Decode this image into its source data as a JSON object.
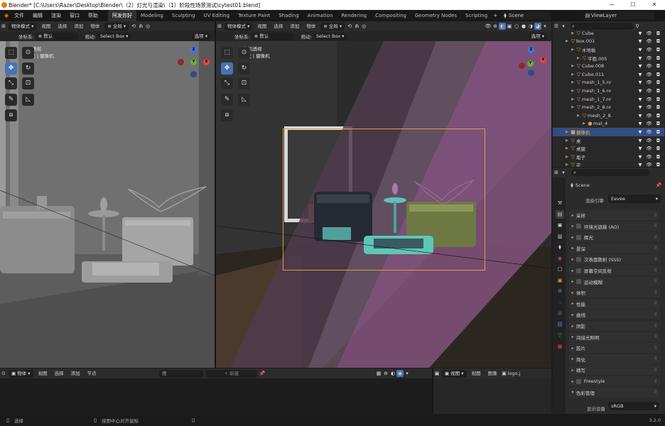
{
  "titlebar": {
    "title": "Blender* [C:\\Users\\Razer\\Desktop\\Blender\\（2）灯光与渲染\\（1）阶段性场景测试\\cytest01.blend]"
  },
  "menu": {
    "items": [
      "文件",
      "编辑",
      "渲染",
      "窗口",
      "帮助"
    ]
  },
  "workspaces": [
    "阿发你好",
    "Modeling",
    "Sculpting",
    "UV Editing",
    "Texture Paint",
    "Shading",
    "Animation",
    "Rendering",
    "Compositing",
    "Geometry Nodes",
    "Scripting"
  ],
  "top_right": {
    "scene": "Scene",
    "view_layer": "ViewLayer"
  },
  "viewport_left": {
    "mode": "物体模式",
    "menus": [
      "视图",
      "选择",
      "添加",
      "物体"
    ],
    "orientation": "全局",
    "coord_label": "坐标系:",
    "coord_value": "默认",
    "drag_label": "拖动:",
    "drag_value": "Select Box",
    "options": "选项",
    "overlay_title": "用户透视",
    "overlay_sub": "(1) 光 | 摄像机"
  },
  "viewport_right": {
    "mode": "物体模式",
    "menus": [
      "视图",
      "选择",
      "添加",
      "物体"
    ],
    "orientation": "全局",
    "coord_label": "坐标系:",
    "coord_value": "默认",
    "drag_label": "拖动:",
    "drag_value": "Select Box",
    "options": "选项",
    "overlay_title": "摄像机透视",
    "overlay_sub": "(1) 光 | 摄像机"
  },
  "gizmo": {
    "x": "X",
    "y": "Y",
    "z": "Z"
  },
  "outliner": {
    "rows": [
      {
        "name": "Cube",
        "indent": 3,
        "icon": "▽"
      },
      {
        "name": "box.001",
        "indent": 2,
        "icon": "▽"
      },
      {
        "name": "木地板",
        "indent": 3,
        "icon": "▽"
      },
      {
        "name": "平面.005",
        "indent": 4,
        "icon": "▽"
      },
      {
        "name": "Cube.008",
        "indent": 3,
        "icon": "▽"
      },
      {
        "name": "Cube.011",
        "indent": 3,
        "icon": "▽"
      },
      {
        "name": "mesh_1_5.nr",
        "indent": 3,
        "icon": "▽"
      },
      {
        "name": "mesh_1_6.nr",
        "indent": 3,
        "icon": "▽"
      },
      {
        "name": "mesh_1_7.nr",
        "indent": 3,
        "icon": "▽"
      },
      {
        "name": "mesh_2_8.nr",
        "indent": 3,
        "icon": "▽"
      },
      {
        "name": "mesh_2_8.",
        "indent": 4,
        "icon": "▽"
      },
      {
        "name": "mat_4",
        "indent": 5,
        "icon": "●"
      },
      {
        "name": "摄像机",
        "indent": 2,
        "icon": "■"
      },
      {
        "name": "桌",
        "indent": 2,
        "icon": "▽"
      },
      {
        "name": "桌腿",
        "indent": 2,
        "icon": "▽"
      },
      {
        "name": "瓶子",
        "indent": 2,
        "icon": "▽"
      },
      {
        "name": "花",
        "indent": 2,
        "icon": "▽"
      }
    ],
    "selected_index": 12
  },
  "properties": {
    "scene_name": "Scene",
    "render_engine_label": "渲染引擎",
    "render_engine_value": "Eevee",
    "panels": [
      "采样",
      "环境光遮蔽 (AO)",
      "辉光",
      "景深",
      "次表面散射 (SSS)",
      "屏幕空间反射",
      "运动模糊",
      "体积",
      "性能",
      "曲线",
      "阴影",
      "间接光照明",
      "胶片",
      "简化",
      "精写",
      "Freestyle",
      "色彩管理"
    ],
    "panels_with_checkbox": [
      1,
      2,
      4,
      5,
      6,
      15
    ],
    "display_device_label": "显示设备",
    "display_device_value": "sRGB"
  },
  "shader_editor": {
    "mode": "物体",
    "menus": [
      "视图",
      "选择",
      "添加",
      "节点"
    ],
    "slot": "槽",
    "new_button": "新建"
  },
  "image_editor": {
    "menus": [
      "视图",
      "视图",
      "图像"
    ],
    "image": "logo.j"
  },
  "statusbar": {
    "select": "选择",
    "center": "视图中心对齐鼠标",
    "version": "3.2.0"
  },
  "colors": {
    "accent": "#4772b3",
    "selected_row": "#334d80",
    "camera_frame": "#e39a45",
    "gizmo_x": "#e84545",
    "gizmo_y": "#6ab02a",
    "gizmo_z": "#3a7ae0"
  }
}
